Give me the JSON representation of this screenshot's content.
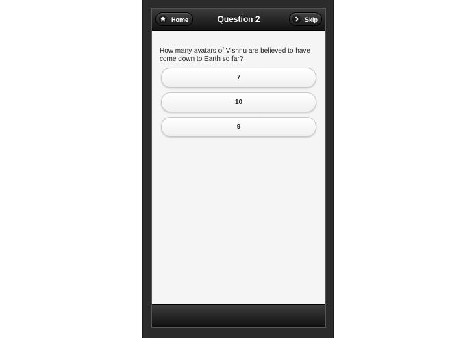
{
  "header": {
    "title": "Question 2",
    "home_label": "Home",
    "skip_label": "Skip"
  },
  "question": {
    "text": "How many avatars of Vishnu are believed to have come down to Earth so far?"
  },
  "answers": [
    {
      "label": "7"
    },
    {
      "label": "10"
    },
    {
      "label": "9"
    }
  ],
  "icons": {
    "home": "home-icon",
    "skip": "chevron-right-icon"
  }
}
